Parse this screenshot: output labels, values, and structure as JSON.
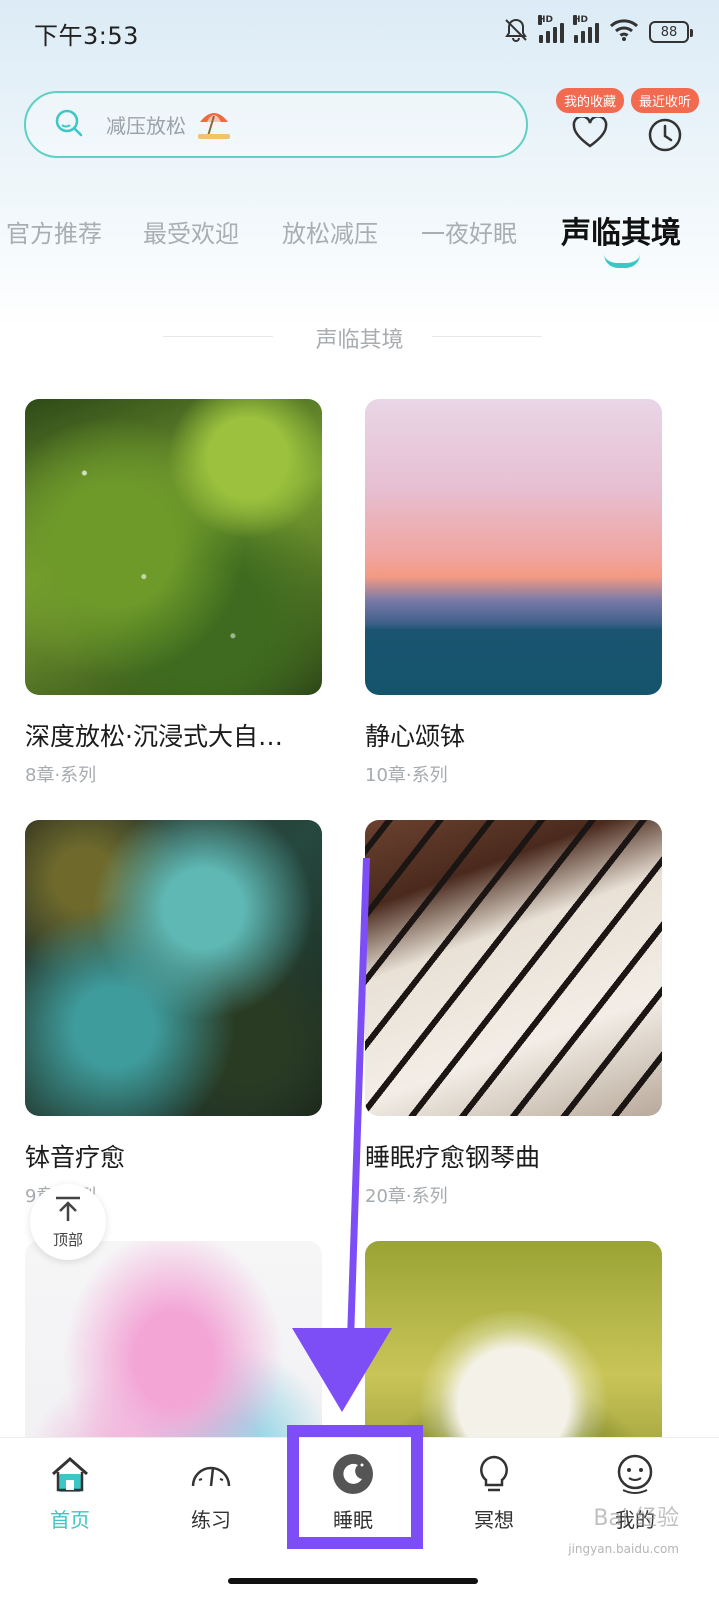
{
  "status_bar": {
    "time": "下午3:53",
    "battery": "88",
    "network_label": "HD"
  },
  "search": {
    "placeholder": "减压放松",
    "emoji": "⛱"
  },
  "header_actions": {
    "favorites_label": "我的收藏",
    "recent_label": "最近收听"
  },
  "tabs": [
    {
      "label": "官方推荐",
      "active": false
    },
    {
      "label": "最受欢迎",
      "active": false
    },
    {
      "label": "放松减压",
      "active": false
    },
    {
      "label": "一夜好眠",
      "active": false
    },
    {
      "label": "声临其境",
      "active": true
    }
  ],
  "section": {
    "title": "声临其境"
  },
  "cards": [
    {
      "title": "深度放松·沉浸式大自…",
      "meta": "8章·系列"
    },
    {
      "title": "静心颂钵",
      "meta": "10章·系列"
    },
    {
      "title": "钵音疗愈",
      "meta": "9章·系列"
    },
    {
      "title": "睡眠疗愈钢琴曲",
      "meta": "20章·系列"
    },
    {
      "title": "",
      "meta": ""
    },
    {
      "title": "",
      "meta": ""
    }
  ],
  "back_to_top": {
    "label": "顶部"
  },
  "bottom_nav": [
    {
      "label": "首页",
      "icon": "home-icon",
      "active": true
    },
    {
      "label": "练习",
      "icon": "gauge-icon",
      "active": false
    },
    {
      "label": "睡眠",
      "icon": "moon-icon",
      "active": false
    },
    {
      "label": "冥想",
      "icon": "lightbulb-icon",
      "active": false
    },
    {
      "label": "我的",
      "icon": "profile-icon",
      "active": false
    }
  ],
  "colors": {
    "accent": "#3cc6c6",
    "badge": "#f26a4f",
    "annotation": "#7d4ef5"
  },
  "watermark": {
    "brand": "Bai 经验",
    "url": "jingyan.baidu.com"
  }
}
